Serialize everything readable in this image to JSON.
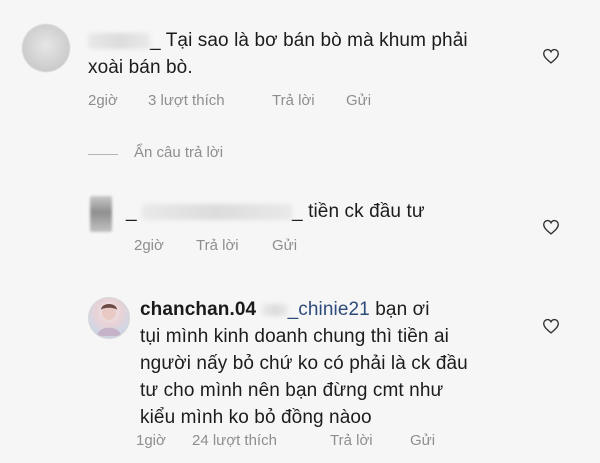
{
  "comments": [
    {
      "username_suffix": "_",
      "text_line1": "Tại sao là bơ bán bò mà khum phải",
      "text_line2": "xoài bán bò.",
      "time": "2giờ",
      "likes": "3 lượt thích",
      "reply": "Trả lời",
      "send": "Gửi"
    },
    {
      "username_suffix": "_",
      "text": "tiền ck đầu tư",
      "time": "2giờ",
      "reply": "Trả lời",
      "send": "Gửi"
    },
    {
      "username": "chanchan.04",
      "mention": "_chinie21",
      "text_line1": "bạn ơi",
      "text_line2": "tụi mình kinh doanh chung thì tiền ai",
      "text_line3": "người nấy bỏ chứ ko có phải là ck đầu",
      "text_line4": "tư cho mình nên bạn đừng cmt như",
      "text_line5": "kiểu mình ko bỏ đồng nàoo",
      "time": "1giờ",
      "likes": "24 lượt thích",
      "reply": "Trả lời",
      "send": "Gửi"
    }
  ],
  "hidden_replies_label": "Ẩn câu trả lời",
  "colors": {
    "background": "#f6f6f6",
    "text": "#1c1c1c",
    "meta": "#8e8e8e",
    "mention": "#2d4b7a"
  }
}
